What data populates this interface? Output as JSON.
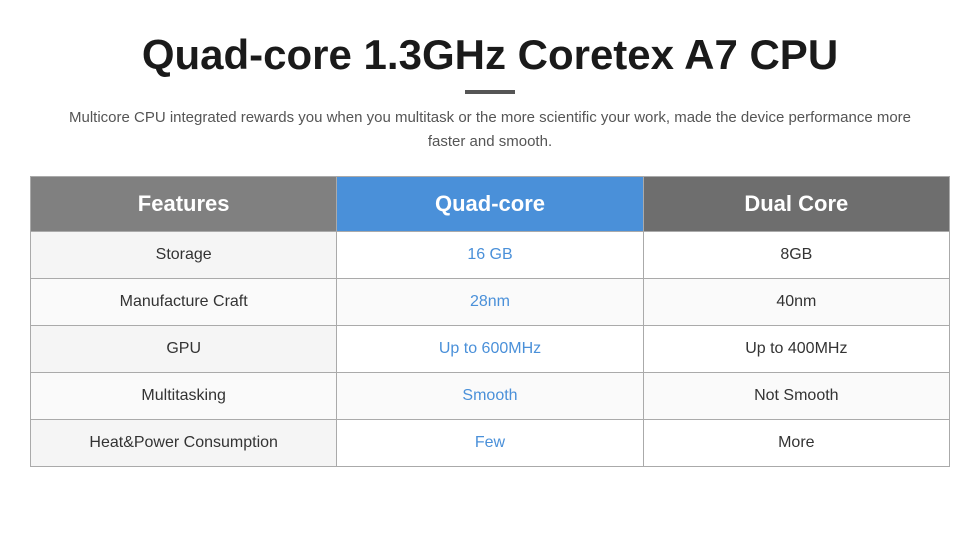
{
  "header": {
    "title": "Quad-core 1.3GHz Coretex A7 CPU",
    "subtitle": "Multicore CPU integrated rewards you when you multitask or the more scientific your work, made the device performance more faster and smooth."
  },
  "table": {
    "columns": {
      "features": "Features",
      "quadcore": "Quad-core",
      "dualcore": "Dual Core"
    },
    "rows": [
      {
        "feature": "Storage",
        "quadcore_value": "16 GB",
        "dualcore_value": "8GB"
      },
      {
        "feature": "Manufacture Craft",
        "quadcore_value": "28nm",
        "dualcore_value": "40nm"
      },
      {
        "feature": "GPU",
        "quadcore_value": "Up to 600MHz",
        "dualcore_value": "Up to 400MHz"
      },
      {
        "feature": "Multitasking",
        "quadcore_value": "Smooth",
        "dualcore_value": "Not Smooth"
      },
      {
        "feature": "Heat&Power Consumption",
        "quadcore_value": "Few",
        "dualcore_value": "More"
      }
    ]
  }
}
